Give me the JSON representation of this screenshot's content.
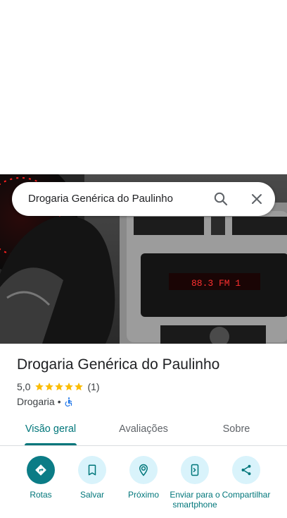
{
  "search": {
    "query": "Drogaria Genérica do Paulinho"
  },
  "place": {
    "title": "Drogaria Genérica do Paulinho",
    "rating": "5,0",
    "stars": 5,
    "review_count": "(1)",
    "category": "Drogaria",
    "separator": "•",
    "accessibility_icon": "wheelchair-icon"
  },
  "photo": {
    "radio_display": "88.3 FM 1"
  },
  "tabs": [
    {
      "label": "Visão geral",
      "active": true
    },
    {
      "label": "Avaliações",
      "active": false
    },
    {
      "label": "Sobre",
      "active": false
    }
  ],
  "actions": [
    {
      "label": "Rotas",
      "icon": "directions-icon"
    },
    {
      "label": "Salvar",
      "icon": "bookmark-icon"
    },
    {
      "label": "Próximo",
      "icon": "nearby-icon"
    },
    {
      "label": "Enviar para o smartphone",
      "icon": "send-to-phone-icon"
    },
    {
      "label": "Compartilhar",
      "icon": "share-icon"
    }
  ],
  "colors": {
    "accent": "#00767a",
    "primary_action": "#0b7c86",
    "action_bg": "#d9f3fb",
    "star": "#fbbc04",
    "radio_text": "#ff3030"
  }
}
